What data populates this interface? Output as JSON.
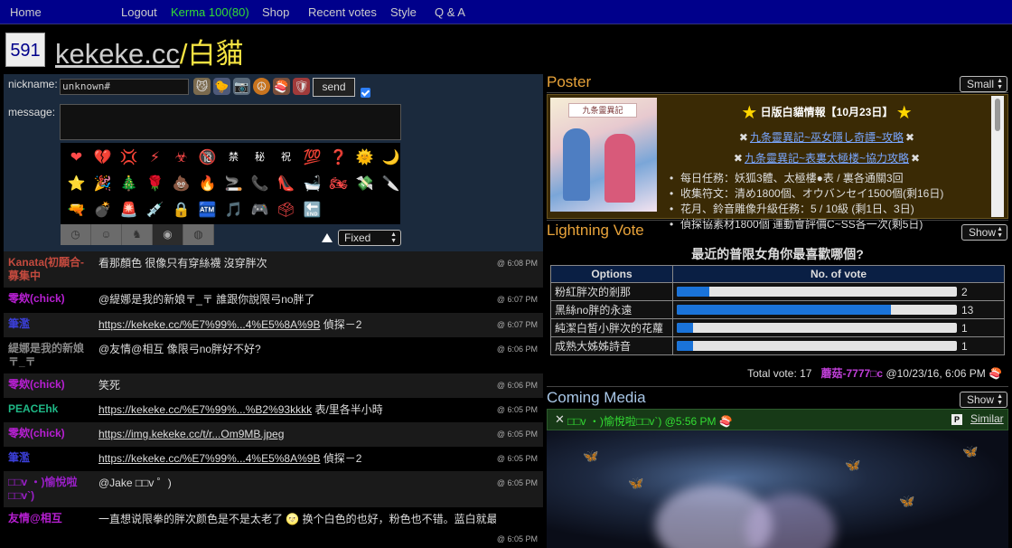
{
  "nav": {
    "home": "Home",
    "logout": "Logout",
    "kerma": "Kerma 100(80)",
    "shop": "Shop",
    "recent_votes": "Recent votes",
    "style": "Style",
    "qa": "Q & A"
  },
  "room": {
    "user_count": "591",
    "site": "kekeke.cc",
    "slash": "/",
    "name": "白貓"
  },
  "form": {
    "nickname_label": "nickname:",
    "nickname_value": "unknown#",
    "message_label": "message:",
    "send_label": "send",
    "emoji_mode": "Fixed",
    "quick_icons": [
      "cat-icon",
      "chicks-icon",
      "camera-icon",
      "peace-icon",
      "sushi-icon",
      "shield-icon"
    ],
    "emojis": [
      "❤",
      "💔",
      "💢",
      "⚡",
      "☣",
      "🔞",
      "禁",
      "秘",
      "祝",
      "💯",
      "❓",
      "🌞",
      "🌙",
      "⭐",
      "🎉",
      "🎄",
      "🌹",
      "💩",
      "🔥",
      "🚬",
      "📞",
      "👠",
      "🛁",
      "🏍",
      "💸",
      "🔪",
      "🔫",
      "💣",
      "🚨",
      "💉",
      "🔒",
      "🏧",
      "🎵",
      "🎮",
      "🗳",
      "🔚"
    ],
    "emoji_tabs": [
      "clock-icon",
      "smiley-icon",
      "animal-icon",
      "bulb-icon",
      "ball-icon"
    ]
  },
  "chat": [
    {
      "name": "Kanata(初願合-募集中",
      "name_color": "#c44a3e",
      "text": "看那顏色 很像只有穿絲襪 沒穿胖次",
      "link": false,
      "time": "@ 6:08 PM"
    },
    {
      "name": "零欸(chick)",
      "name_color": "#b81fd3",
      "text": "@緹娜是我的新娘〒_〒 誰跟你說限弓no胖了",
      "link": false,
      "time": "@ 6:07 PM"
    },
    {
      "name": "筆濫",
      "name_color": "#3b3fd8",
      "text": "https://kekeke.cc/%E7%99%...4%E5%8A%9B",
      "suffix": " 偵探－2",
      "link": true,
      "time": "@ 6:07 PM"
    },
    {
      "name": "緹娜是我的新娘〒_〒",
      "name_color": "#888888",
      "text": "@友情@相互 像限弓no胖好不好?",
      "link": false,
      "time": "@ 6:06 PM"
    },
    {
      "name": "零欸(chick)",
      "name_color": "#b81fd3",
      "text": "笑死",
      "link": false,
      "time": "@ 6:06 PM"
    },
    {
      "name": "PEACEhk",
      "name_color": "#1fb886",
      "text": "https://kekeke.cc/%E7%99%...%B2%93kkkk",
      "suffix": " 表/里各半小時",
      "link": true,
      "time": "@ 6:05 PM"
    },
    {
      "name": "零欸(chick)",
      "name_color": "#b81fd3",
      "text": "https://img.kekeke.cc/t/r...Om9MB.jpeg",
      "link": true,
      "time": "@ 6:05 PM"
    },
    {
      "name": "筆濫",
      "name_color": "#3b3fd8",
      "text": "https://kekeke.cc/%E7%99%...4%E5%8A%9B",
      "suffix": " 偵探－2",
      "link": true,
      "time": "@ 6:05 PM"
    },
    {
      "name": "□□v ・)愉悅啦□□v`)",
      "name_color": "#9a1fc8",
      "text": "@Jake □□v ゜)",
      "link": false,
      "time": "@ 6:05 PM"
    },
    {
      "name": "友情@相互",
      "name_color": "#b81fd3",
      "text": "一直想说限拳的胖次颜色是不是太老了 🌝 换个白色的也好，粉色也不错。蓝白就最好了 👍",
      "link": false,
      "time": "@ 6:05 PM"
    }
  ],
  "poster": {
    "title": "Poster",
    "size_option": "Small",
    "image_title": "九条靈異記",
    "headline": "日版白貓情報【10月23日】",
    "link1": "九条靈異記~巫女隱し奇譚~攻略",
    "link2": "九条靈異記~表裏太極楼~協力攻略",
    "items": [
      "每日任務：妖狐3體、太極樓●表 / 裏各通關3回",
      "收集符文：清め1800個、オウバンセイ1500個(剩16日)",
      "花月、鈴音雕像升級任務：5 / 10級 (剩1日、3日)",
      "偵探協素材1800個 運動會評價C~SS各一次(剩5日)"
    ]
  },
  "vote": {
    "title": "Lightning Vote",
    "show_option": "Show",
    "question": "最近的普限女角你最喜歡哪個?",
    "col_options": "Options",
    "col_votes": "No. of vote",
    "total_label": "Total vote: 17",
    "author": "蘑菇-7777□c",
    "date": "@10/23/16, 6:06 PM",
    "max": 17
  },
  "chart_data": {
    "type": "bar",
    "categories": [
      "粉紅胖次的剎那",
      "黑絲no胖的永遠",
      "純潔白皙小胖次的花蘿",
      "成熟大姊姊詩音"
    ],
    "values": [
      2,
      13,
      1,
      1
    ],
    "title": "最近的普限女角你最喜歡哪個?",
    "xlabel": "Options",
    "ylabel": "No. of vote",
    "ylim": [
      0,
      17
    ]
  },
  "media": {
    "title": "Coming Media",
    "show_option": "Show",
    "close": "✕",
    "user": "□□v ・)愉悅啦□□v`)",
    "time": "@5:56 PM",
    "p_label": "P",
    "similar": "Similar"
  },
  "colors": {
    "nav_bg": "#00008b",
    "kerma": "#33dd33",
    "section_title": "#e8a33a",
    "vote_bar": "#1a73d9"
  }
}
